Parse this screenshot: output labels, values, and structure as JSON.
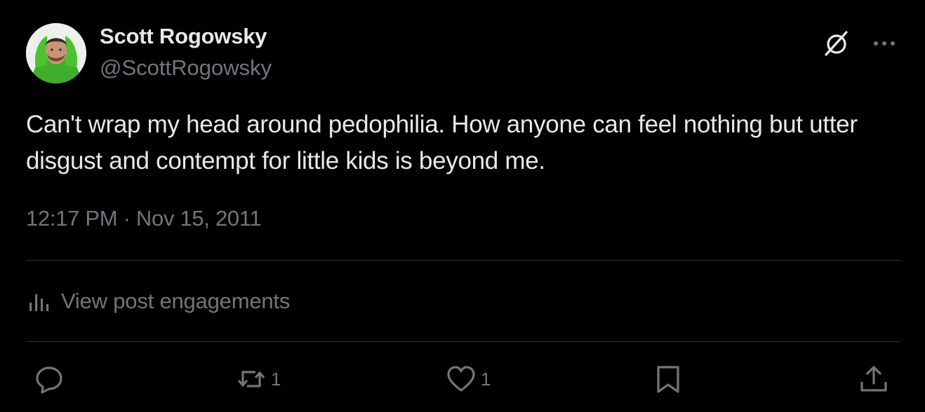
{
  "author": {
    "display_name": "Scott Rogowsky",
    "handle": "@ScottRogowsky",
    "avatar_icon": "avatar-photo"
  },
  "header_icons": {
    "grok": "grok-icon",
    "more": "more-icon"
  },
  "post": {
    "text": "Can't wrap my head around pedophilia. How anyone can feel nothing but utter disgust and contempt for little kids is beyond me.",
    "timestamp": "12:17 PM · Nov 15, 2011"
  },
  "engagements": {
    "label": "View post engagements",
    "icon": "bar-chart-icon"
  },
  "actions": {
    "reply": {
      "icon": "reply-icon"
    },
    "repost": {
      "icon": "repost-icon",
      "count": "1"
    },
    "like": {
      "icon": "heart-icon",
      "count": "1"
    },
    "bookmark": {
      "icon": "bookmark-icon"
    },
    "share": {
      "icon": "share-icon"
    }
  },
  "colors": {
    "background": "#000000",
    "primary_text": "#e7e9ea",
    "secondary_text": "#71767b",
    "divider": "#2f3336"
  }
}
